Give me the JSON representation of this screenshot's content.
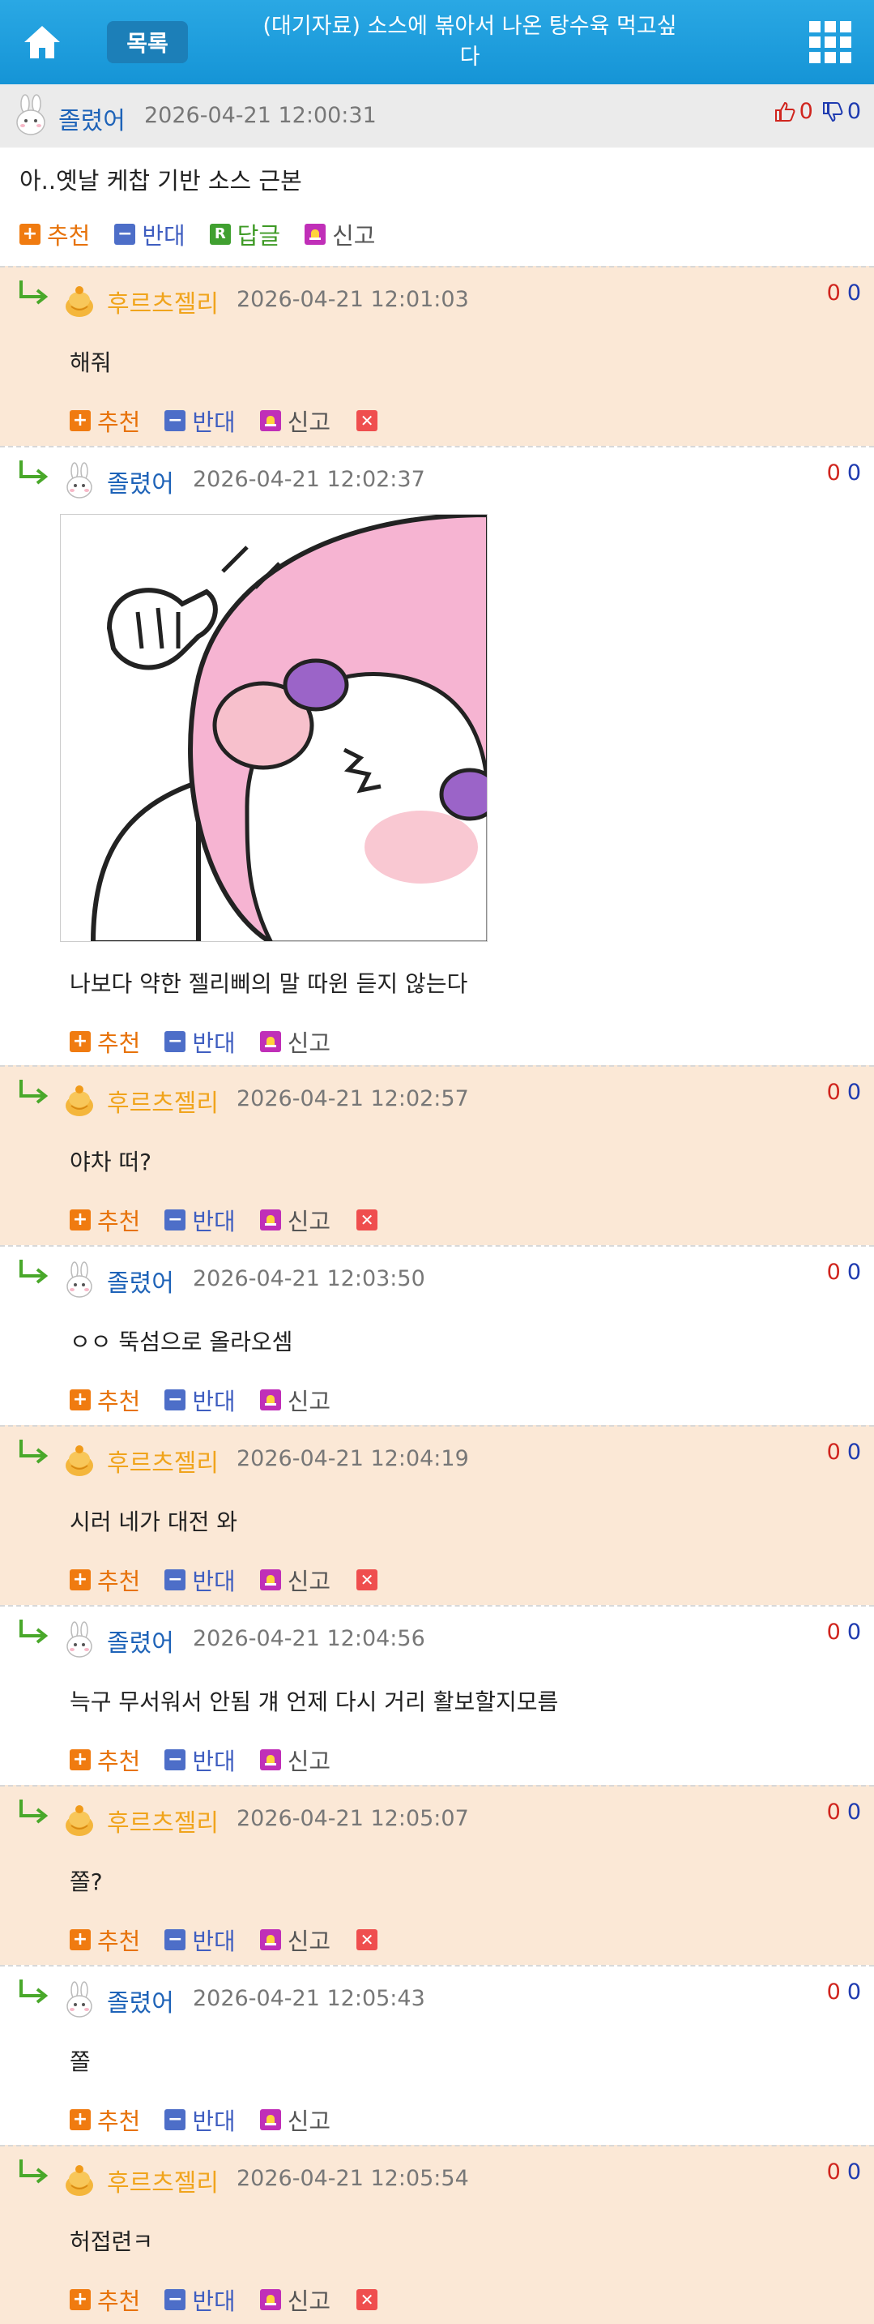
{
  "header": {
    "list_label": "목록",
    "title_line1": "(대기자료) 소스에 볶아서 나온 탕수육 먹고싶",
    "title_line2": "다"
  },
  "post": {
    "nickname": "졸렸어",
    "time": "2026-04-21 12:00:31",
    "up": "0",
    "down": "0",
    "text": "아..옛날 케찹 기반 소스 근본",
    "actions": {
      "recommend": "추천",
      "oppose": "반대",
      "reply_icon": "R",
      "reply": "답글",
      "report": "신고"
    }
  },
  "actions": {
    "recommend": "추천",
    "oppose": "반대",
    "report": "신고",
    "plus": "+",
    "minus": "−",
    "delete": "✕"
  },
  "comments": [
    {
      "nickname": "후르츠젤리",
      "time": "2026-04-21 12:01:03",
      "up": "0",
      "down": "0",
      "text": "해줘"
    },
    {
      "nickname": "졸렸어",
      "time": "2026-04-21 12:02:37",
      "up": "0",
      "down": "0",
      "text": "나보다 약한 젤리삐의 말 따윈 듣지 않는다"
    },
    {
      "nickname": "후르츠젤리",
      "time": "2026-04-21 12:02:57",
      "up": "0",
      "down": "0",
      "text": "야차 떠?"
    },
    {
      "nickname": "졸렸어",
      "time": "2026-04-21 12:03:50",
      "up": "0",
      "down": "0",
      "text": "ㅇㅇ 뚝섬으로 올라오셈"
    },
    {
      "nickname": "후르츠젤리",
      "time": "2026-04-21 12:04:19",
      "up": "0",
      "down": "0",
      "text": "시러 네가 대전 와"
    },
    {
      "nickname": "졸렸어",
      "time": "2026-04-21 12:04:56",
      "up": "0",
      "down": "0",
      "text": "늑구 무서워서 안됨 걔 언제 다시 거리 활보할지모름"
    },
    {
      "nickname": "후르츠젤리",
      "time": "2026-04-21 12:05:07",
      "up": "0",
      "down": "0",
      "text": "쫄?"
    },
    {
      "nickname": "졸렸어",
      "time": "2026-04-21 12:05:43",
      "up": "0",
      "down": "0",
      "text": "쫄"
    },
    {
      "nickname": "후르츠젤리",
      "time": "2026-04-21 12:05:54",
      "up": "0",
      "down": "0",
      "text": "허접련ㅋ"
    }
  ],
  "colors": {
    "header": "#1594d6",
    "peach": "#fbe8d6",
    "jelly_nick": "#f0a41c",
    "bunny_nick": "#1e63b8"
  }
}
